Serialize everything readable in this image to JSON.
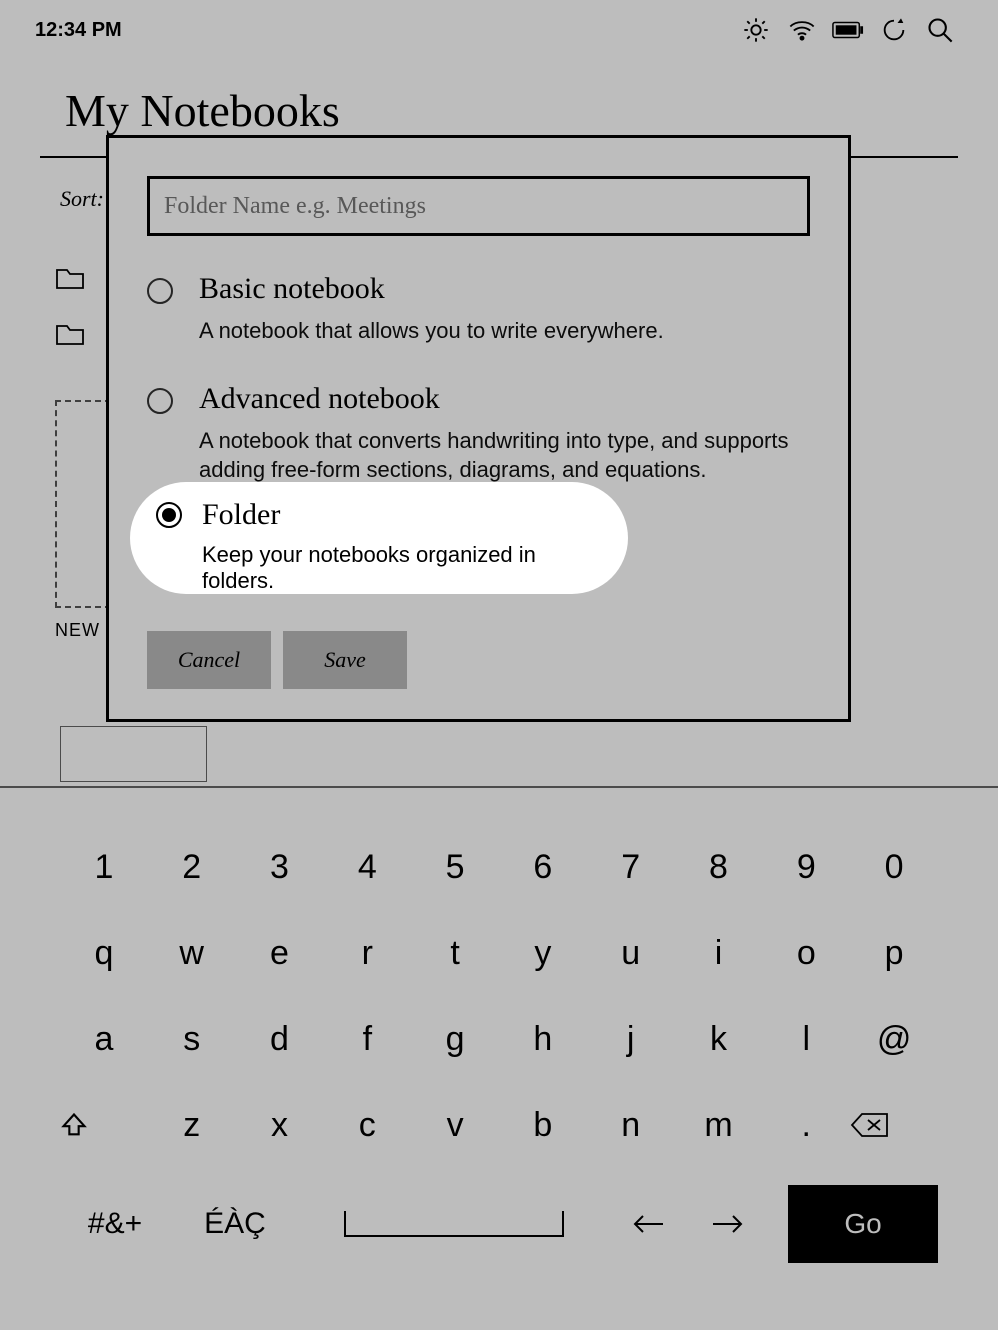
{
  "statusbar": {
    "time": "12:34 PM"
  },
  "page": {
    "title": "My Notebooks",
    "sort_label": "Sort:",
    "new_label": "NEW"
  },
  "dialog": {
    "placeholder": "Folder Name e.g. Meetings",
    "options": {
      "basic": {
        "title": "Basic notebook",
        "desc": "A notebook that allows you to write everywhere."
      },
      "advanced": {
        "title": "Advanced notebook",
        "desc": "A notebook that converts handwriting into type, and supports adding free-form sections, diagrams, and equations."
      },
      "folder": {
        "title": "Folder",
        "desc": "Keep your notebooks organized in folders."
      }
    },
    "cancel": "Cancel",
    "save": "Save"
  },
  "keyboard": {
    "row1": [
      "1",
      "2",
      "3",
      "4",
      "5",
      "6",
      "7",
      "8",
      "9",
      "0"
    ],
    "row2": [
      "q",
      "w",
      "e",
      "r",
      "t",
      "y",
      "u",
      "i",
      "o",
      "p"
    ],
    "row3": [
      "a",
      "s",
      "d",
      "f",
      "g",
      "h",
      "j",
      "k",
      "l",
      "@"
    ],
    "row4_letters": [
      "z",
      "x",
      "c",
      "v",
      "b",
      "n",
      "m",
      "."
    ],
    "symbols": "#&+",
    "accents": "ÉÀÇ",
    "go": "Go"
  }
}
